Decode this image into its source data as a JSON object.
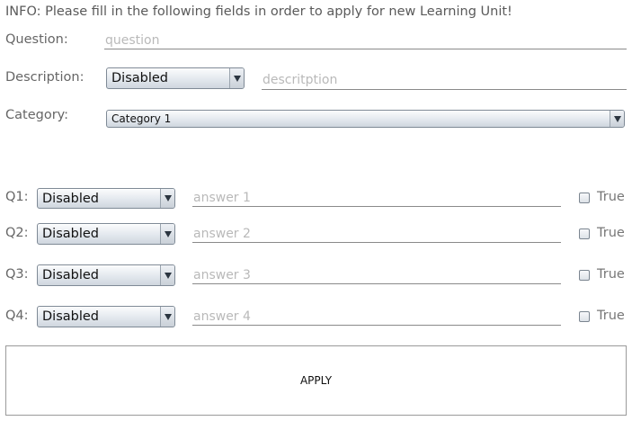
{
  "info_text": "INFO: Please fill in the following fields in order to apply for new Learning Unit!",
  "question": {
    "label": "Question:",
    "placeholder": "question",
    "value": ""
  },
  "description": {
    "label": "Description:",
    "combo_value": "Disabled",
    "placeholder": "descritption",
    "value": ""
  },
  "category": {
    "label": "Category:",
    "combo_value": "Category 1"
  },
  "answers": [
    {
      "label": "Q1:",
      "combo_value": "Disabled",
      "placeholder": "answer 1",
      "checkbox_label": "True",
      "checked": false
    },
    {
      "label": "Q2:",
      "combo_value": "Disabled",
      "placeholder": "answer 2",
      "checkbox_label": "True",
      "checked": false
    },
    {
      "label": "Q3:",
      "combo_value": "Disabled",
      "placeholder": "answer 3",
      "checkbox_label": "True",
      "checked": false
    },
    {
      "label": "Q4:",
      "combo_value": "Disabled",
      "placeholder": "answer 4",
      "checkbox_label": "True",
      "checked": false
    }
  ],
  "apply_label": "APPLY"
}
